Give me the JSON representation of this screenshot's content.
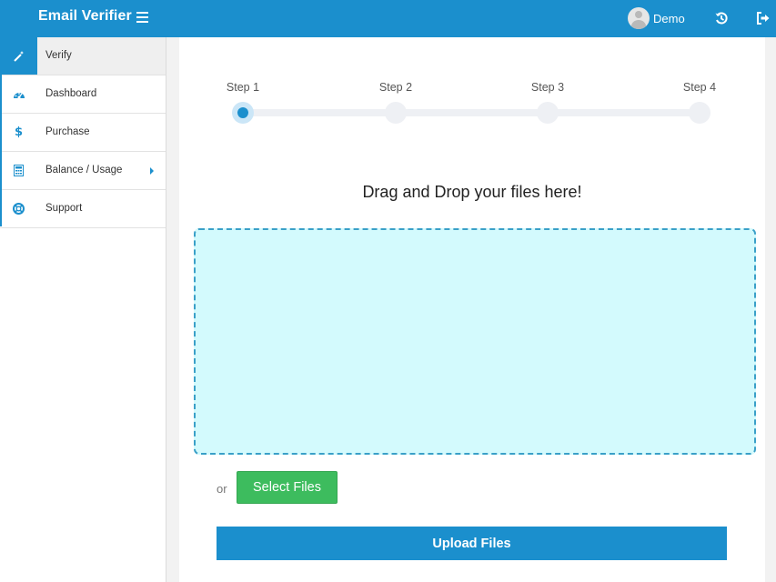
{
  "header": {
    "brand": "Email Verifier",
    "user_name": "Demo",
    "brand_color": "#1b8fcd"
  },
  "sidebar": {
    "items": [
      {
        "label": "Verify",
        "icon": "magic-wand-icon",
        "active": true
      },
      {
        "label": "Dashboard",
        "icon": "dashboard-icon"
      },
      {
        "label": "Purchase",
        "icon": "dollar-icon"
      },
      {
        "label": "Balance / Usage",
        "icon": "calculator-icon",
        "has_submenu": true
      },
      {
        "label": "Support",
        "icon": "life-ring-icon"
      }
    ]
  },
  "steps": {
    "labels": [
      "Step 1",
      "Step 2",
      "Step 3",
      "Step 4"
    ],
    "current": 1
  },
  "upload": {
    "title": "Drag and Drop your files here!",
    "or_text": "or",
    "select_label": "Select Files",
    "upload_label": "Upload Files"
  }
}
